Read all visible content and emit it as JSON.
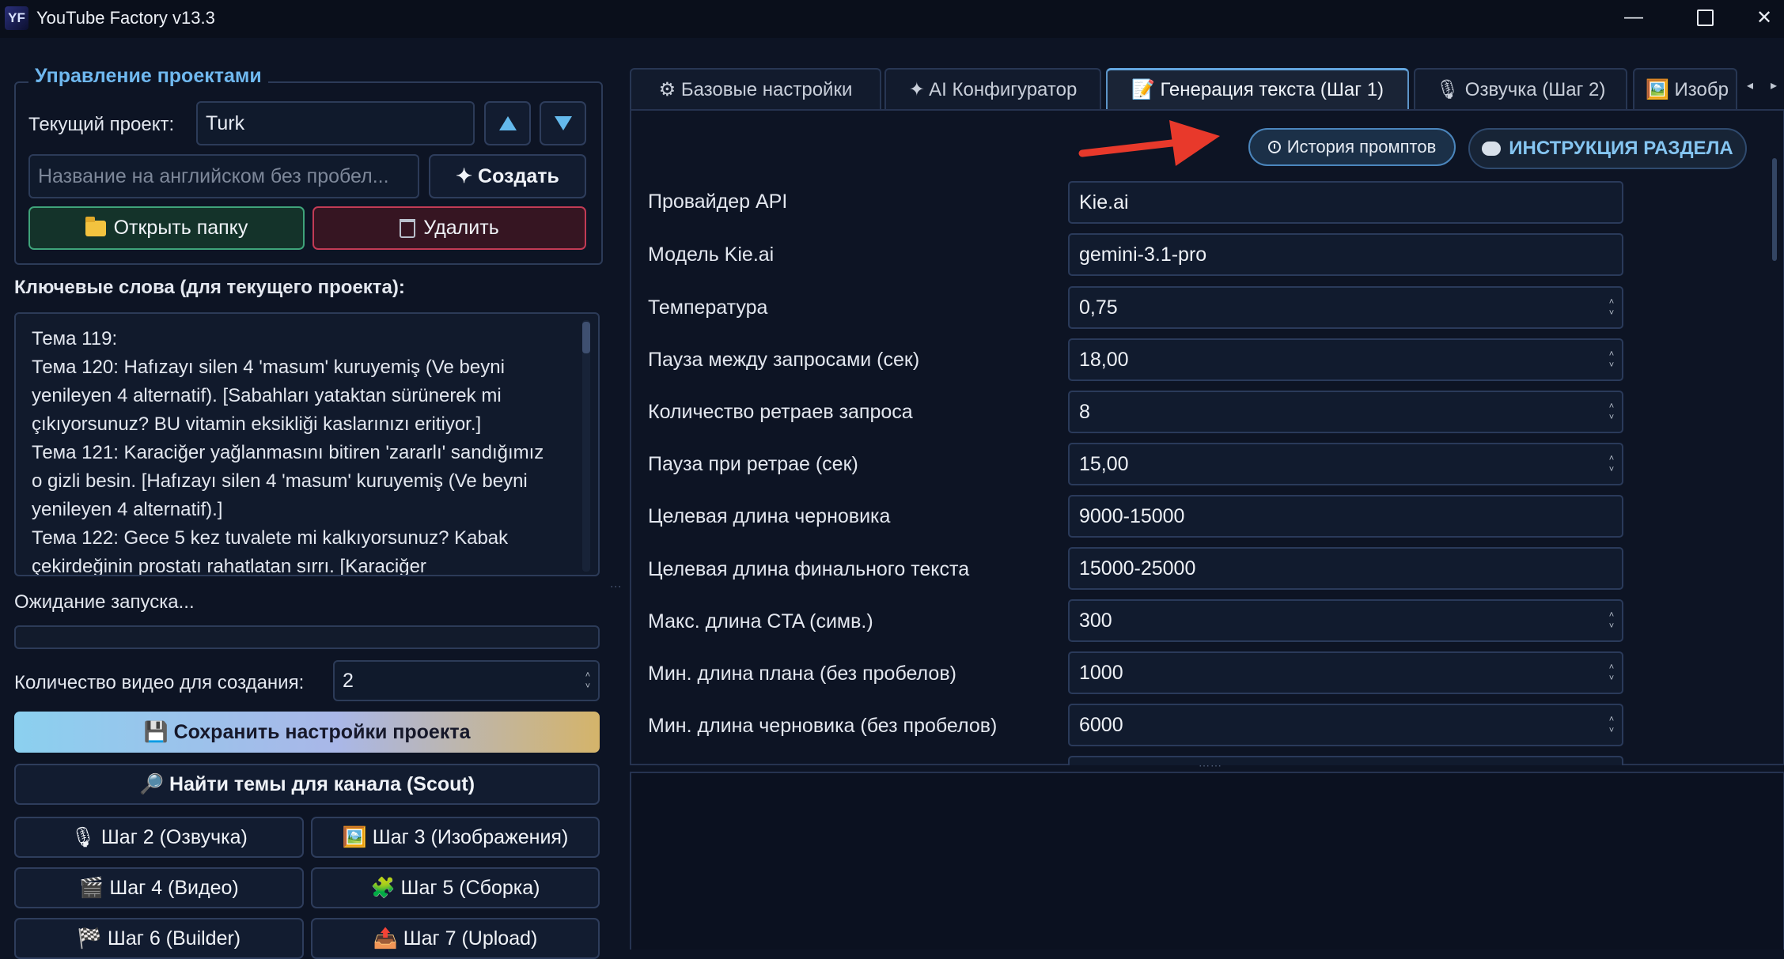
{
  "window": {
    "app_icon_text": "YF",
    "title": "YouTube Factory v13.3",
    "minimize_symbol": "—",
    "close_symbol": "✕"
  },
  "projects": {
    "group_title": "Управление проектами",
    "current_label": "Текущий проект:",
    "current_value": "Turk",
    "new_placeholder": "Название на английском без пробел...",
    "create_label": "✦ Создать",
    "open_folder_label": "Открыть папку",
    "delete_label": "Удалить"
  },
  "keywords": {
    "title": "Ключевые слова (для текущего проекта):",
    "lines": [
      "Тема 119:",
      "Тема 120: Hafızayı silen 4 'masum' kuruyemiş (Ve beyni",
      "yenileyen 4 alternatif). [Sabahları yataktan sürünerek mi",
      "çıkıyorsunuz? BU vitamin eksikliği kaslarınızı eritiyor.]",
      "Тема 121: Karaciğer yağlanmasını bitiren 'zararlı' sandığımız",
      "o gizli besin. [Hafızayı silen 4 'masum' kuruyemiş (Ve beyni",
      "yenileyen 4 alternatif).]",
      "Тема 122: Gece 5 kez tuvalete mi kalkıyorsunuz? Kabak",
      "çekirdeğinin prostatı rahatlatan sırrı. [Karaciğer"
    ]
  },
  "status": {
    "text": "Ожидание запуска...",
    "progress_fraction": 0
  },
  "video_count": {
    "label": "Количество видео для создания:",
    "value": "2"
  },
  "actions": {
    "save_label": "💾 Сохранить настройки проекта",
    "scout_label": "🔎 Найти темы для канала (Scout)",
    "step2_label": "🎙 Шаг 2 (Озвучка)",
    "step3_label": "🖼️ Шаг 3 (Изображения)",
    "step4_label": "🎬 Шаг 4 (Видео)",
    "step5_label": "🧩 Шаг 5 (Сборка)",
    "step6_label": "🏁 Шаг 6 (Builder)",
    "step7_label": "📤 Шаг 7 (Upload)"
  },
  "tabs": [
    {
      "label": "⚙ Базовые настройки"
    },
    {
      "label": "✦ AI Конфигуратор"
    },
    {
      "label": "📝 Генерация текста (Шаг 1)"
    },
    {
      "label": "🎙 Озвучка (Шаг 2)"
    },
    {
      "label": "🖼️ Изобр"
    }
  ],
  "tab_nav": {
    "left": "◂",
    "right": "▸"
  },
  "header_buttons": {
    "history_label": "История промптов",
    "instructions_label": "ИНСТРУКЦИЯ РАЗДЕЛА"
  },
  "settings": [
    {
      "label": "Провайдер API",
      "value": "Kie.ai"
    },
    {
      "label": "Модель Kie.ai",
      "value": "gemini-3.1-pro"
    },
    {
      "label": "Температура",
      "value": "0,75"
    },
    {
      "label": "Пауза между запросами (сек)",
      "value": "18,00"
    },
    {
      "label": "Количество ретраев запроса",
      "value": "8"
    },
    {
      "label": "Пауза при ретрае (сек)",
      "value": "15,00"
    },
    {
      "label": "Целевая длина черновика",
      "value": "9000-15000"
    },
    {
      "label": "Целевая длина финального текста",
      "value": "15000-25000"
    },
    {
      "label": "Макс. длина CTA (симв.)",
      "value": "300"
    },
    {
      "label": "Мин. длина плана (без пробелов)",
      "value": "1000"
    },
    {
      "label": "Мин. длина черновика (без пробелов)",
      "value": "6000"
    }
  ],
  "colors": {
    "accent": "#6fb8ef",
    "background": "#0d1424",
    "annotation_arrow": "#e8392b"
  }
}
